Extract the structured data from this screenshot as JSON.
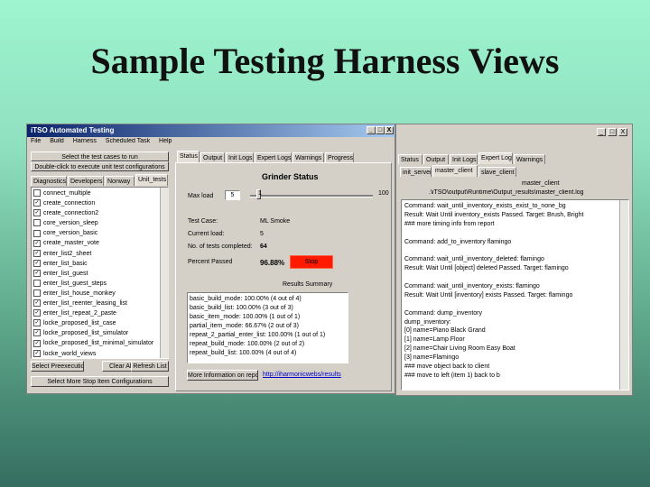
{
  "slide": {
    "title": "Sample Testing Harness Views"
  },
  "win1": {
    "title": "iTSO Automated Testing",
    "controls": [
      "_",
      "□",
      "X"
    ],
    "menu": [
      "File",
      "Build",
      "Harness",
      "Scheduled Task",
      "Help"
    ],
    "select_buttons": [
      "Select the test cases to run",
      "Double-click to execute unit test configurations"
    ],
    "left_tabs": [
      "Diagnostics",
      "Developers",
      "Nonway",
      "Unit_tests"
    ],
    "tests": [
      {
        "name": "connect_multiple",
        "checked": false
      },
      {
        "name": "create_connection",
        "checked": true
      },
      {
        "name": "create_connection2",
        "checked": true
      },
      {
        "name": "core_version_sleep",
        "checked": false
      },
      {
        "name": "core_version_basic",
        "checked": false
      },
      {
        "name": "create_master_vote",
        "checked": true
      },
      {
        "name": "enter_list2_sheet",
        "checked": true
      },
      {
        "name": "enter_list_basic",
        "checked": true
      },
      {
        "name": "enter_list_guest",
        "checked": true
      },
      {
        "name": "enter_list_guest_steps",
        "checked": false
      },
      {
        "name": "enter_list_house_monkey",
        "checked": false
      },
      {
        "name": "enter_list_reenter_leasing_list",
        "checked": true
      },
      {
        "name": "enter_list_repeat_2_paste",
        "checked": true
      },
      {
        "name": "locke_proposed_list_case",
        "checked": true
      },
      {
        "name": "locke_proposed_list_simulator",
        "checked": true
      },
      {
        "name": "locke_proposed_list_minimal_simulator",
        "checked": true
      },
      {
        "name": "locke_world_views",
        "checked": true
      }
    ],
    "bottom_buttons": [
      "Select Preexecution",
      "Clear All",
      "Refresh List"
    ],
    "bottom_wide_button": "Select More Stop Item Configurations",
    "right_tabs": [
      "Status",
      "Output",
      "Init Logs",
      "Expert Logs",
      "Warnings",
      "Progress"
    ],
    "grinder": {
      "title": "Grinder Status",
      "max_label": "Max load",
      "max_value": "5",
      "slider_min": "1",
      "slider_max": "100",
      "slider_level": 0.05,
      "rows": [
        {
          "label": "Test Case:",
          "value": "ML Smoke"
        },
        {
          "label": "Current load:",
          "value": "5"
        },
        {
          "label": "No. of tests completed:",
          "value": "64"
        },
        {
          "label": "Percent Passed",
          "value": "96.88%"
        }
      ],
      "stop_label": "Stop"
    },
    "results": {
      "title": "Results Summary",
      "lines": [
        "basic_build_mode: 100.00% (4 out of 4)",
        "basic_build_list: 100.00% (3 out of 3)",
        "basic_item_mode: 100.00% (1 out of 1)",
        "partial_item_mode: 66.67% (2 out of 3)",
        "repeat_2_partial_enter_list: 100.00% (1 out of 1)",
        "repeat_build_mode: 100.00% (2 out of 2)",
        "repeat_build_list: 100.00% (4 out of 4)"
      ],
      "button": "More Information on report",
      "link": "http://iharmonicwebs/results"
    }
  },
  "win2": {
    "controls": [
      "_",
      "□",
      "X"
    ],
    "tabs": [
      "Status",
      "Output",
      "Init Logs",
      "Expert Logs",
      "Warnings"
    ],
    "subtabs": [
      "init_server",
      "master_client",
      "slave_client"
    ],
    "path_title": "master_client",
    "path": ".\\iTSO\\output\\Runtime\\Output_results\\master_client.log",
    "log": [
      "Command: wait_until_inventory_exists_exist_to_none_bg",
      "Result: Wait Until inventory_exists Passed. Target: Brush, Bright",
      "### more timing info from report",
      "",
      "Command: add_to_inventory flamingo",
      "",
      "Command: wait_until_inventory_deleted: flamingo",
      "Result: Wait Until [object] deleted Passed. Target: flamingo",
      "",
      "Command: wait_until_inventory_exists: flamingo",
      "Result: Wait Until [inventory] exists Passed. Target: flamingo",
      "",
      "Command: dump_inventory",
      "dump_inventory:",
      "  [0] name=Piano  Black Grand",
      "  [1] name=Lamp  Floor",
      "  [2] name=Chair  Living Room Easy Boat",
      "  [3] name=Flamingo",
      "### move object back to client",
      "### move to left (item 1) back to b"
    ]
  }
}
